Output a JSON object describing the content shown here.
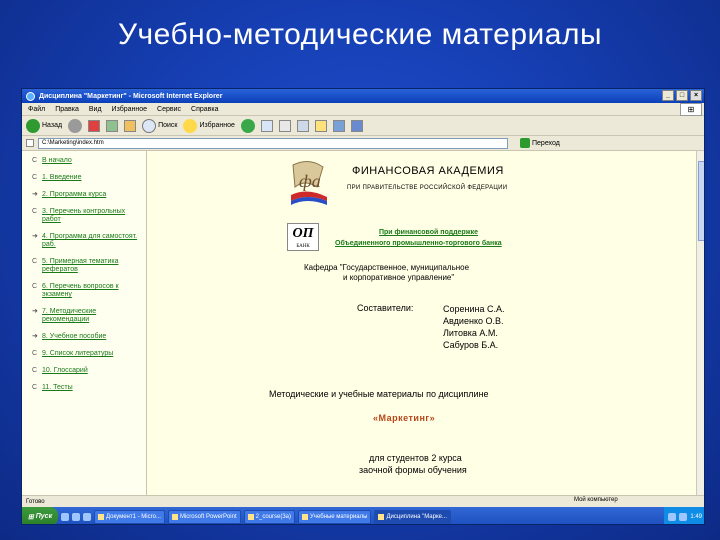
{
  "slide": {
    "title": "Учебно-методические материалы"
  },
  "window": {
    "title": "Дисциплина \"Маркетинг\" - Microsoft Internet Explorer",
    "minimize": "_",
    "maximize": "□",
    "close": "×"
  },
  "menu": [
    "Файл",
    "Правка",
    "Вид",
    "Избранное",
    "Сервис",
    "Справка"
  ],
  "toolbar": {
    "back": "Назад",
    "search": "Поиск",
    "favorites": "Избранное"
  },
  "address": {
    "value": "C:\\Marketing\\index.htm",
    "go": "Переход"
  },
  "nav": {
    "items": [
      {
        "mark": "С",
        "label": "В начало"
      },
      {
        "mark": "С",
        "label": "1. Введение"
      },
      {
        "mark": "➜",
        "label": "2. Программа курса"
      },
      {
        "mark": "С",
        "label": "3. Перечень контрольных работ"
      },
      {
        "mark": "➜",
        "label": "4. Программа для самостоят. раб."
      },
      {
        "mark": "С",
        "label": "5. Примерная тематика рефератов"
      },
      {
        "mark": "С",
        "label": "6. Перечень вопросов к экзамену"
      },
      {
        "mark": "➜",
        "label": "7. Методические рекомендации"
      },
      {
        "mark": "➜",
        "label": "8. Учебное пособие"
      },
      {
        "mark": "С",
        "label": "9. Список литературы"
      },
      {
        "mark": "С",
        "label": "10. Глоссарий"
      },
      {
        "mark": "С",
        "label": "11. Тесты"
      }
    ]
  },
  "main": {
    "academy": "ФИНАНСОВАЯ АКАДЕМИЯ",
    "academy_sub": "ПРИ ПРАВИТЕЛЬСТВЕ РОССИЙСКОЙ ФЕДЕРАЦИИ",
    "bank_logo": "ОП",
    "bank_logo_sub": "БАНК",
    "support1": "При финансовой поддержке",
    "support2": "Объединенного промышленно-торгового банка",
    "kafedra1": "Кафедра \"Государственное, муниципальное",
    "kafedra2": "и корпоративное управление\"",
    "compilers_label": "Составители:",
    "compilers": [
      "Соренина С.А.",
      "Авдиенко О.В.",
      "Литовка А.М.",
      "Сабуров Б.А."
    ],
    "method": "Методические и учебные материалы по дисциплине",
    "subject": "«Маркетинг»",
    "students1": "для студентов 2 курса",
    "students2": "заочной формы обучения"
  },
  "status": {
    "left": "Готово",
    "zone": "Мой компьютер"
  },
  "taskbar": {
    "start": "Пуск",
    "items": [
      "Документ1 - Micro...",
      "Microsoft PowerPoint",
      "2_course(3a)",
      "Учебные материалы",
      "Дисциплина \"Марке..."
    ],
    "clock": "1:49"
  },
  "colors": {
    "desktop": "#163fb3",
    "link": "#1a7a1a",
    "subject": "#b8461a",
    "page_bg": "#ffffe6"
  }
}
